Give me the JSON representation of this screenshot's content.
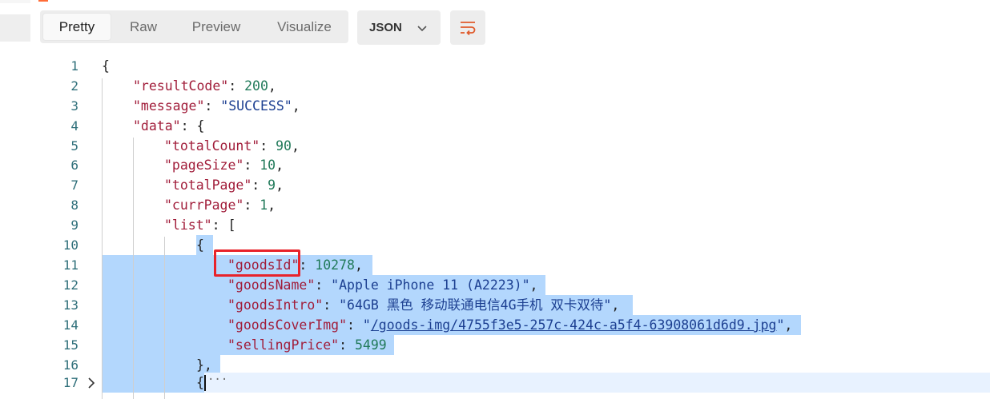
{
  "toolbar": {
    "tabs": [
      "Pretty",
      "Raw",
      "Preview",
      "Visualize"
    ],
    "format": "JSON"
  },
  "editor": {
    "line_numbers": [
      "1",
      "2",
      "3",
      "4",
      "5",
      "6",
      "7",
      "8",
      "9",
      "10",
      "11",
      "12",
      "13",
      "14",
      "15",
      "16",
      "17"
    ],
    "l1": "{",
    "l2_key": "\"resultCode\"",
    "l2_val": "200",
    "l3_key": "\"message\"",
    "l3_val": "\"SUCCESS\"",
    "l4_key": "\"data\"",
    "l4_rest": ": {",
    "l5_key": "\"totalCount\"",
    "l5_val": "90",
    "l6_key": "\"pageSize\"",
    "l6_val": "10",
    "l7_key": "\"totalPage\"",
    "l7_val": "9",
    "l8_key": "\"currPage\"",
    "l8_val": "1",
    "l9_key": "\"list\"",
    "l9_rest": ": [",
    "l10": "{",
    "l11_key": "\"goodsId\"",
    "l11_val": "10278",
    "l12_key": "\"goodsName\"",
    "l12_val": "\"Apple iPhone 11 (A2223)\"",
    "l13_key": "\"goodsIntro\"",
    "l13_val": "\"64GB 黑色 移动联通电信4G手机 双卡双待\"",
    "l14_key": "\"goodsCoverImg\"",
    "l14_q": "\"",
    "l14_link": "/goods-img/4755f3e5-257c-424c-a5f4-63908061d6d9.jpg",
    "l14_q2": "\"",
    "l15_key": "\"sellingPrice\"",
    "l15_val": "5499",
    "l16": "},",
    "l17": "{",
    "collapsed": "···"
  }
}
